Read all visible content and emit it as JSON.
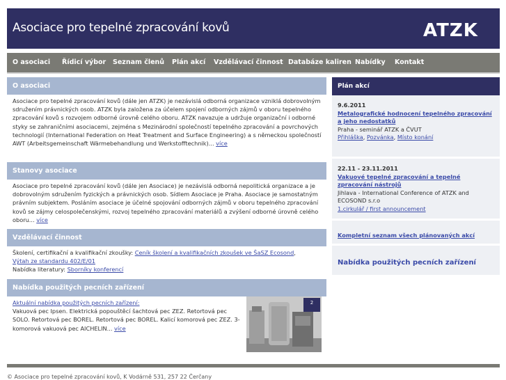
{
  "header": {
    "site_title": "Asociace pro tepelné zpracování kovů",
    "logo_text": "ATZK"
  },
  "nav": [
    "O asociaci",
    "Řídicí výbor",
    "Seznam členů",
    "Plán akcí",
    "Vzdělávací činnost",
    "Databáze kaliren",
    "Nabídky",
    "Kontakt"
  ],
  "sections": {
    "about": {
      "title": "O asociaci",
      "text": "Asociace pro tepelné zpracování kovů (dále jen ATZK) je nezávislá odborná organizace vzniklá dobrovolným sdružením právnických osob. ATZK byla založena za účelem spojení odborných zájmů v oboru tepelného zpracování kovů s rozvojem odborné úrovně celého oboru. ATZK navazuje a udržuje organizační i odborné styky se zahraničními asociacemi, zejména s Mezinárodní společností tepelného zpracování a povrchových technologií (International Federation on Heat Treatment and Surface Engineering) a s německou společností AWT (Arbeitsgemeinschaft Wärmebehandlung und Werkstofftechnik)...",
      "more": "více"
    },
    "statutes": {
      "title": "Stanovy asociace",
      "text": "Asociace pro tepelné zpracování kovů (dále jen Asociace) je nezávislá odborná nepolitická organizace a je dobrovolným sdružením fyzických a právnických osob. Sídlem Asociace je Praha. Asociace je samostatným právním subjektem. Posláním asociace je účelné spojování odborných zájmů v oboru tepelného zpracování kovů se zájmy celospolečenskými, rozvoj tepelného zpracování materiálů a zvýšení odborné úrovně celého oboru...",
      "more": "více"
    },
    "education": {
      "title": "Vzdělávací činnost",
      "line1_prefix": "Školení, certifikační a kvalifikační zkoušky: ",
      "line1_link": "Ceník školení a kvalifikačních zkoušek ve ŠaSZ Ecosond",
      "line1_sep": ",",
      "line2_link": "Výtah ze standardu 402/E/01",
      "line3_prefix": "Nabídka literatury: ",
      "line3_link": "Sborníky konferencí"
    },
    "offers": {
      "title": "Nabídka použitých pecních zařízení",
      "link": "Aktuální nabídka použitých pecních zařízení:",
      "text": "Vakuová pec Ipsen. Elektrická popouštěcí šachtová pec ZEZ. Retortová pec SOLO. Retortová pec BOREL. Retortová pec BOREL. Kalicí komorová pec ZEZ. 3-komorová vakuová pec AICHELIN...",
      "more": "více"
    }
  },
  "plan": {
    "title": "Plán akcí",
    "events": [
      {
        "date": "9.6.2011",
        "title": "Metalografické hodnocení tepelného zpracování a jeho nedostatků",
        "desc": "Praha - seminář ATZK a ČVUT",
        "links": [
          "Přihláška",
          "Pozvánka",
          "Místo konání"
        ]
      },
      {
        "date": "22.11 - 23.11.2011",
        "title": "Vakuové tepelné zpracování a tepelné zpracování nástrojů",
        "desc": "Jihlava - International Conference of ATZK and ECOSOND s.r.o",
        "links": [
          "1.cirkulář / first announcement"
        ]
      }
    ],
    "all_link": "Kompletní seznam všech plánovaných akcí",
    "offers_link": "Nabídka použitých pecních zařízení"
  },
  "footer": {
    "text": "© Asociace pro tepelné zpracování kovů, K Vodárně 531, 257 22 Čerčany"
  },
  "colors": {
    "header_bg": "#2f2f62",
    "nav_bg": "#7a7a74",
    "section_head_bg": "#a6b6d0",
    "link": "#3a4aa8"
  }
}
